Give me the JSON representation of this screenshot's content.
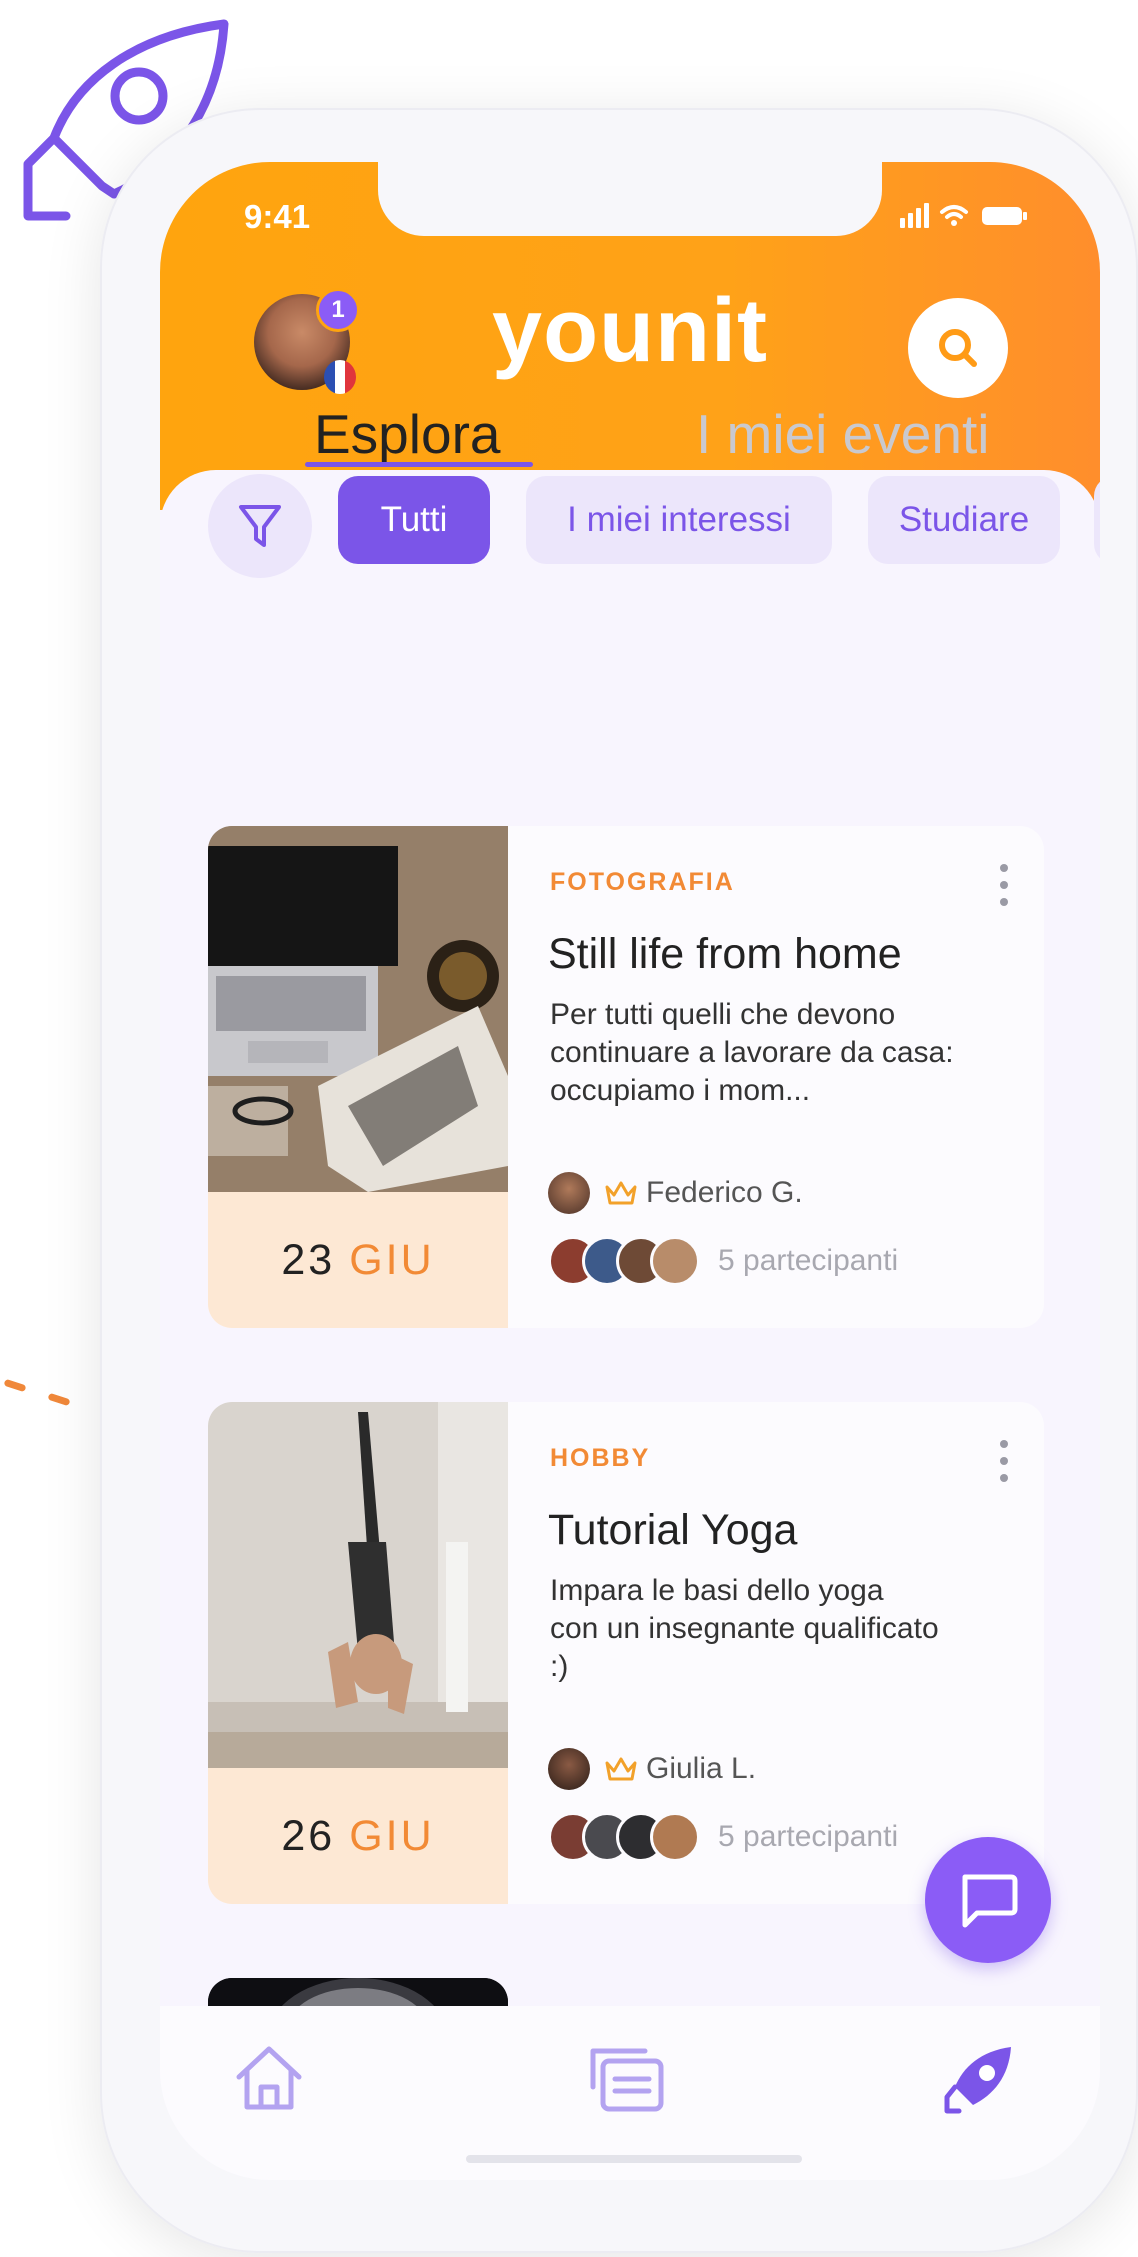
{
  "status_bar": {
    "time": "9:41"
  },
  "header": {
    "logo": "younit",
    "notification_count": "1"
  },
  "tabs": [
    {
      "label": "Esplora",
      "active": true
    },
    {
      "label": "I miei eventi",
      "active": false
    }
  ],
  "filters": {
    "chips": [
      {
        "label": "Tutti",
        "active": true
      },
      {
        "label": "I miei interessi",
        "active": false
      },
      {
        "label": "Studiare",
        "active": false
      }
    ]
  },
  "events": [
    {
      "category": "FOTOGRAFIA",
      "title": "Still life from home",
      "description": "Per tutti quelli che devono continuare a lavorare da casa: occupiamo i mom...",
      "host": "Federico G.",
      "participants": "5 partecipanti",
      "day": "23",
      "month": "GIU"
    },
    {
      "category": "HOBBY",
      "title": "Tutorial Yoga",
      "description": "Impara le basi dello yoga con un insegnante qualificato :)",
      "host": "Giulia L.",
      "participants": "5 partecipanti",
      "day": "26",
      "month": "GIU"
    }
  ],
  "colors": {
    "brand_orange": "#ffa40e",
    "accent_purple": "#7b55e8",
    "chip_bg": "#ece6fb",
    "date_bg": "#fde8d4",
    "category_orange": "#f28a35"
  },
  "icons": {
    "search": "search-icon",
    "filter": "filter-icon",
    "more": "more-vertical-icon",
    "crown": "crown-icon",
    "chat": "chat-icon",
    "home": "home-icon",
    "events": "events-icon",
    "explore": "rocket-icon"
  }
}
